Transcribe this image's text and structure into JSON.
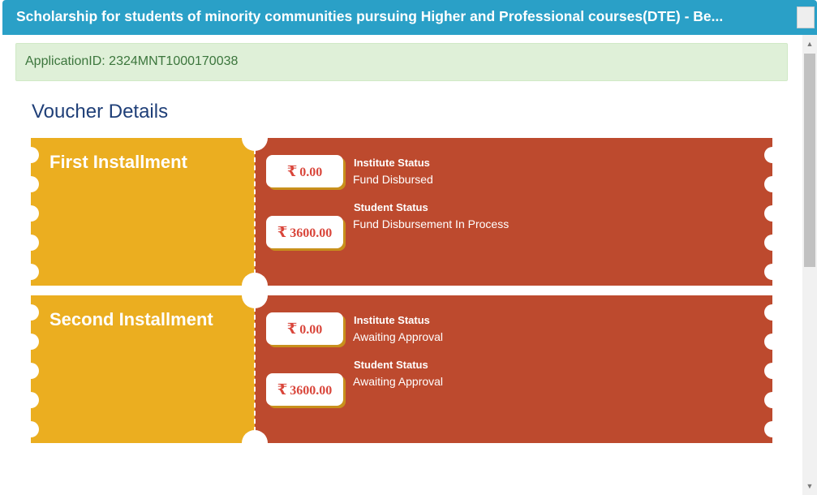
{
  "header": {
    "title": "Scholarship for students of minority communities pursuing Higher and Professional courses(DTE) - Be..."
  },
  "alert": {
    "application_id": "ApplicationID: 2324MNT1000170038"
  },
  "section": {
    "title": "Voucher Details"
  },
  "currency_symbol": "₹",
  "vouchers": [
    {
      "title": "First Installment",
      "institute": {
        "amount": "0.00",
        "label": "Institute Status",
        "status": "Fund Disbursed"
      },
      "student": {
        "amount": "3600.00",
        "label": "Student Status",
        "status": "Fund Disbursement In Process"
      }
    },
    {
      "title": "Second Installment",
      "institute": {
        "amount": "0.00",
        "label": "Institute Status",
        "status": "Awaiting Approval"
      },
      "student": {
        "amount": "3600.00",
        "label": "Student Status",
        "status": "Awaiting Approval"
      }
    }
  ],
  "colors": {
    "header_bg": "#2aa0c7",
    "alert_bg": "#dff0d8",
    "alert_text": "#3c763d",
    "title_text": "#1f3f78",
    "voucher_left": "#ebae20",
    "voucher_right": "#bd4a2e",
    "amount_text": "#d9453a"
  },
  "icons": {
    "currency": "rupee-icon",
    "scroll_up": "scroll-up-arrow-icon",
    "scroll_down": "scroll-down-arrow-icon"
  }
}
